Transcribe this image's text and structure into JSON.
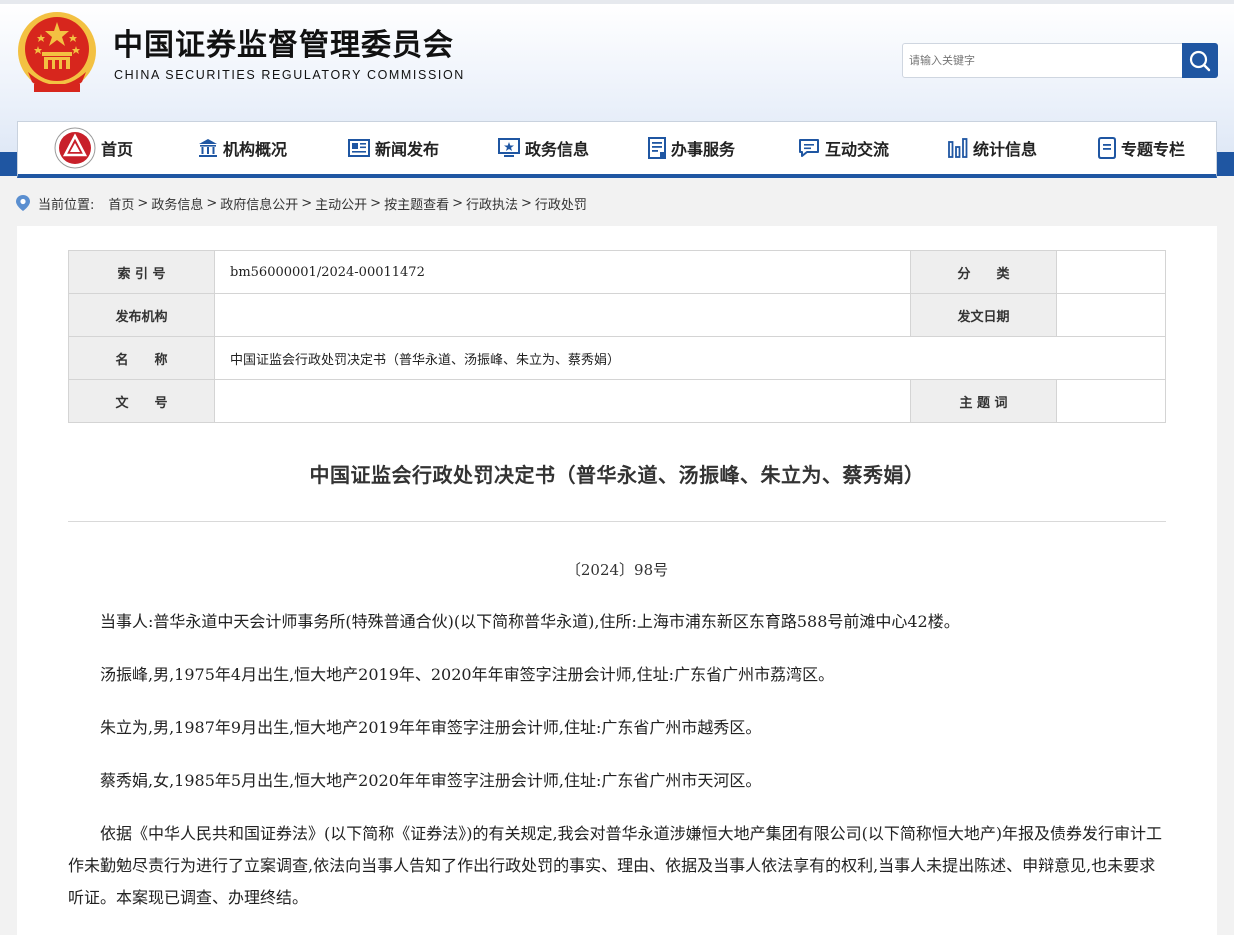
{
  "site": {
    "title_cn": "中国证券监督管理委员会",
    "title_en": "CHINA SECURITIES REGULATORY COMMISSION",
    "search_placeholder": "请输入关键字"
  },
  "colors": {
    "brand_blue": "#1f56a2",
    "emblem_red": "#d7261d",
    "emblem_gold": "#f3c142"
  },
  "nav": [
    {
      "label": "首页",
      "icon": "csrc-logo-icon"
    },
    {
      "label": "机构概况",
      "icon": "building-icon"
    },
    {
      "label": "新闻发布",
      "icon": "newspaper-icon"
    },
    {
      "label": "政务信息",
      "icon": "monitor-star-icon"
    },
    {
      "label": "办事服务",
      "icon": "document-list-icon"
    },
    {
      "label": "互动交流",
      "icon": "chat-icon"
    },
    {
      "label": "统计信息",
      "icon": "bar-chart-icon"
    },
    {
      "label": "专题专栏",
      "icon": "notebook-icon"
    }
  ],
  "breadcrumb": {
    "label": "当前位置:",
    "items": [
      "首页",
      "政务信息",
      "政府信息公开",
      "主动公开",
      "按主题查看",
      "行政执法",
      "行政处罚"
    ],
    "separator": ">"
  },
  "meta": {
    "index_label": "索 引 号",
    "index_value": "bm56000001/2024-00011472",
    "category_label": "分　　类",
    "category_value": "",
    "publisher_label": "发布机构",
    "publisher_value": "",
    "date_label": "发文日期",
    "date_value": "",
    "name_label": "名　　称",
    "name_value": "中国证监会行政处罚决定书（普华永道、汤振峰、朱立为、蔡秀娟）",
    "docno_label": "文　　号",
    "docno_value": "",
    "keyword_label": "主 题 词",
    "keyword_value": ""
  },
  "document": {
    "title": "中国证监会行政处罚决定书（普华永道、汤振峰、朱立为、蔡秀娟）",
    "number": "〔2024〕98号",
    "paragraphs": [
      "当事人:普华永道中天会计师事务所(特殊普通合伙)(以下简称普华永道),住所:上海市浦东新区东育路588号前滩中心42楼。",
      "汤振峰,男,1975年4月出生,恒大地产2019年、2020年年审签字注册会计师,住址:广东省广州市荔湾区。",
      "朱立为,男,1987年9月出生,恒大地产2019年年审签字注册会计师,住址:广东省广州市越秀区。",
      "蔡秀娟,女,1985年5月出生,恒大地产2020年年审签字注册会计师,住址:广东省广州市天河区。",
      "依据《中华人民共和国证券法》(以下简称《证券法》)的有关规定,我会对普华永道涉嫌恒大地产集团有限公司(以下简称恒大地产)年报及债券发行审计工作未勤勉尽责行为进行了立案调查,依法向当事人告知了作出行政处罚的事实、理由、依据及当事人依法享有的权利,当事人未提出陈述、申辩意见,也未要求听证。本案现已调查、办理终结。"
    ]
  }
}
